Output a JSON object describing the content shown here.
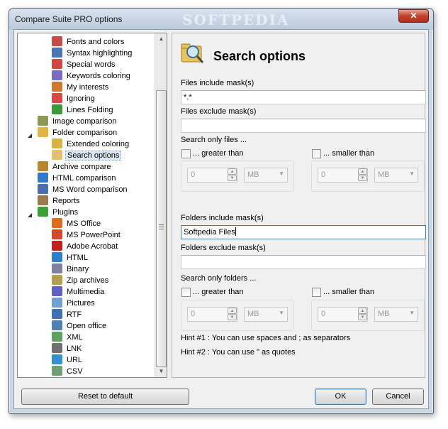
{
  "window": {
    "title": "Compare Suite PRO options",
    "watermark": "SOFTPEDIA",
    "close_glyph": "✕"
  },
  "tree": {
    "items": [
      {
        "label": "Fonts and colors",
        "icon": "fonts-colors-icon"
      },
      {
        "label": "Syntax highlighting",
        "icon": "syntax-icon"
      },
      {
        "label": "Special words",
        "icon": "special-words-icon"
      },
      {
        "label": "Keywords coloring",
        "icon": "keywords-icon"
      },
      {
        "label": "My interests",
        "icon": "interests-icon"
      },
      {
        "label": "Ignoring",
        "icon": "ignoring-icon"
      },
      {
        "label": "Lines Folding",
        "icon": "lines-folding-icon"
      },
      {
        "label": "Image comparison",
        "icon": "image-icon"
      },
      {
        "label": "Folder comparison",
        "icon": "folder-icon"
      },
      {
        "label": "Extended coloring",
        "icon": "extended-coloring-icon"
      },
      {
        "label": "Search options",
        "icon": "search-options-icon"
      },
      {
        "label": "Archive compare",
        "icon": "archive-icon"
      },
      {
        "label": "HTML comparison",
        "icon": "html-compare-icon"
      },
      {
        "label": "MS Word comparison",
        "icon": "word-icon"
      },
      {
        "label": "Reports",
        "icon": "reports-icon"
      },
      {
        "label": "Plugins",
        "icon": "plugins-icon"
      },
      {
        "label": "MS Office",
        "icon": "ms-office-icon"
      },
      {
        "label": "MS PowerPoint",
        "icon": "powerpoint-icon"
      },
      {
        "label": "Adobe Acrobat",
        "icon": "acrobat-icon"
      },
      {
        "label": "HTML",
        "icon": "html-icon"
      },
      {
        "label": "Binary",
        "icon": "binary-icon"
      },
      {
        "label": "Zip archives",
        "icon": "zip-icon"
      },
      {
        "label": "Multimedia",
        "icon": "multimedia-icon"
      },
      {
        "label": "Pictures",
        "icon": "pictures-icon"
      },
      {
        "label": "RTF",
        "icon": "rtf-icon"
      },
      {
        "label": "Open office",
        "icon": "open-office-icon"
      },
      {
        "label": "XML",
        "icon": "xml-icon"
      },
      {
        "label": "LNK",
        "icon": "lnk-icon"
      },
      {
        "label": "URL",
        "icon": "url-icon"
      },
      {
        "label": "CSV",
        "icon": "csv-icon"
      }
    ],
    "selected": "Search options",
    "expander_glyph": "◢"
  },
  "panel": {
    "title": "Search options",
    "files_include_label": "Files include mask(s)",
    "files_include_value": "*.*",
    "files_exclude_label": "Files exclude mask(s)",
    "files_exclude_value": "",
    "search_only_files_label": "Search only files ...",
    "folders_include_label": "Folders include mask(s)",
    "folders_include_value": "Softpedia Files",
    "folders_exclude_label": "Folders exclude mask(s)",
    "folders_exclude_value": "",
    "search_only_folders_label": "Search only folders ...",
    "greater_than_label": "... greater than",
    "smaller_than_label": "... smaller than",
    "spin_value": "0",
    "unit_value": "MB",
    "hint1": "Hint #1 : You can use spaces and ; as separators",
    "hint2": "Hint #2 : You can use \" as quotes"
  },
  "buttons": {
    "reset": "Reset to default",
    "ok": "OK",
    "cancel": "Cancel"
  },
  "glyphs": {
    "spin_up": "▲",
    "spin_down": "▼",
    "combo_arrow": "▼",
    "scroll_up": "▲",
    "scroll_down": "▼"
  }
}
